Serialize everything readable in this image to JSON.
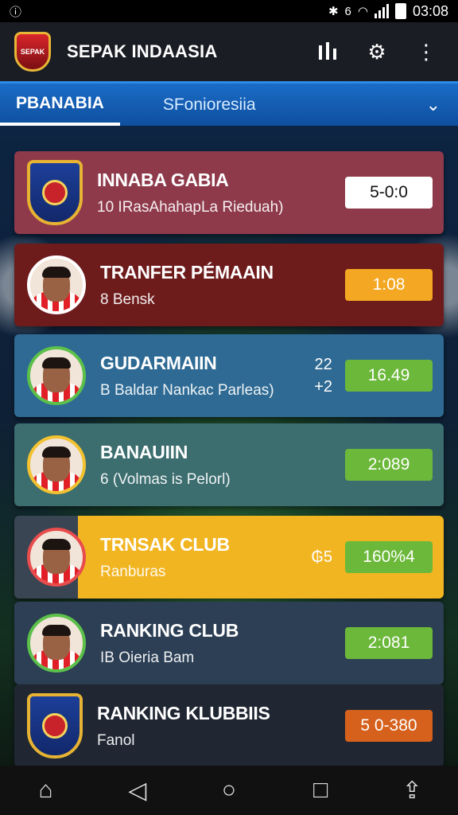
{
  "status_bar": {
    "time": "03:08",
    "network": "6"
  },
  "header": {
    "title": "SEPAK INDAASIA",
    "logo_text": "SEPAK"
  },
  "tabs": [
    {
      "label": "PBANABIA"
    },
    {
      "label": "SFonioresiia"
    }
  ],
  "cards": [
    {
      "title": "INNABA GABIA",
      "subtitle": "10 IRasAhahapLa Rieduah)",
      "badge": "5-0:0",
      "color": "#8e3a4b",
      "badge_color": "#ffffff",
      "badge_text_color": "#111111",
      "icon": "team-crest-icon"
    },
    {
      "title": "TRANFER PÉMAAIN",
      "subtitle": "8 Bensk",
      "badge": "1:08",
      "color": "#6e1b1c",
      "badge_color": "#f4a722",
      "badge_text_color": "#ffffff",
      "icon": "player-avatar-icon"
    },
    {
      "title": "GUDARMAIIN",
      "subtitle": "B Baldar Nankac Parleas)",
      "badge": "16.49",
      "side_top": "22",
      "side_bottom": "+2",
      "color": "#2e6a93",
      "badge_color": "#6cb83a",
      "badge_text_color": "#ffffff",
      "icon": "player-avatar-icon"
    },
    {
      "title": "BANAUIIN",
      "subtitle": "6 (Volmas is Pelorl)",
      "badge": "2:089",
      "color": "#3c6d6f",
      "badge_color": "#6cb83a",
      "badge_text_color": "#ffffff",
      "icon": "player-avatar-icon"
    },
    {
      "title": "TRNSAK CLUB",
      "subtitle": "Ranburas",
      "badge": "160%4",
      "side_top": "₲5",
      "color": "#f2b522",
      "badge_color": "#6cb83a",
      "badge_text_color": "#ffffff",
      "icon": "player-avatar-icon"
    },
    {
      "title": "RANKING CLUB",
      "subtitle": "IB Oieria Bam",
      "badge": "2:081",
      "color": "#2c3f55",
      "badge_color": "#6cb83a",
      "badge_text_color": "#ffffff",
      "icon": "player-avatar-icon"
    },
    {
      "title": "RANKING KLUBBIIS",
      "subtitle": "Fanol",
      "badge": "5 0-380",
      "color": "#202733",
      "badge_color": "#d5611d",
      "badge_text_color": "#ffffff",
      "icon": "team-crest-icon"
    }
  ],
  "nav": {
    "icons": [
      "home-icon",
      "back-icon",
      "home-circle-icon",
      "recents-icon",
      "share-icon"
    ]
  }
}
